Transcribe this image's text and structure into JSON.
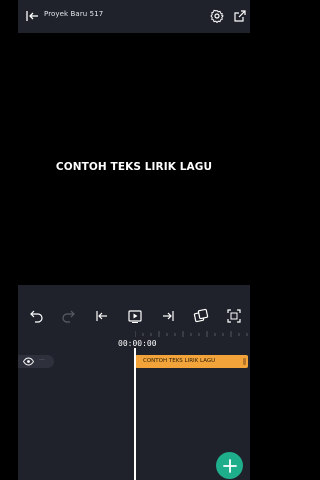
{
  "header": {
    "title": "Proyek Baru 517"
  },
  "preview": {
    "lyric_text": "CONTOH TEKS LIRIK LAGU"
  },
  "timeline": {
    "timecode": "00:00:00",
    "tracks": [
      {
        "clip_label": "CONTOH TEKS LIRIK LAGU",
        "menu": "···"
      }
    ]
  },
  "colors": {
    "panel": "#1f222b",
    "clip": "#f2a33a",
    "add_button": "#1fae8c"
  }
}
